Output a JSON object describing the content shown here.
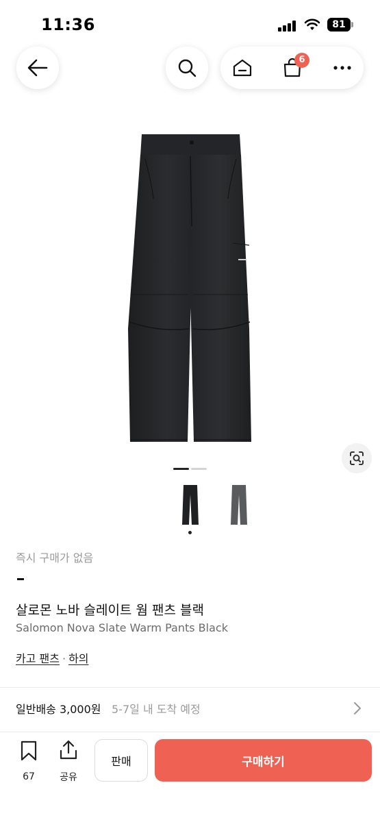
{
  "status": {
    "time": "11:36",
    "battery": "81"
  },
  "nav": {
    "cart_badge": "6"
  },
  "product": {
    "instant_note": "즉시 구매가 없음",
    "title_ko": "살로몬 노바 슬레이트 웜 팬츠 블랙",
    "title_en": "Salomon Nova Slate Warm Pants Black",
    "tags": [
      "카고 팬츠",
      "하의"
    ],
    "tag_separator": "·"
  },
  "shipping": {
    "label": "일반배송 3,000원",
    "eta": "5-7일 내 도착 예정"
  },
  "bottom": {
    "save_count": "67",
    "share_label": "공유",
    "sell_label": "판매",
    "buy_label": "구매하기"
  },
  "icons": [
    "back-arrow-icon",
    "search-icon",
    "home-icon",
    "shopping-bag-icon",
    "more-icon",
    "lens-search-icon",
    "bookmark-icon",
    "share-icon",
    "chevron-right-icon"
  ],
  "colors": {
    "accent": "#ef6253",
    "muted_text": "#9a9a9a"
  }
}
